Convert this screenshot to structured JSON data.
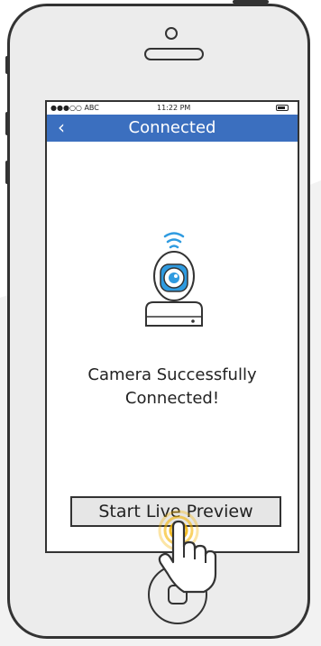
{
  "status_bar": {
    "carrier": "●●●○○ ABC",
    "time": "11:22 PM",
    "battery_icon": "battery-icon"
  },
  "nav": {
    "back_icon": "‹",
    "title": "Connected"
  },
  "content": {
    "camera_icon": "camera-wifi-icon",
    "message_line1": "Camera Successfully",
    "message_line2": "Connected!"
  },
  "actions": {
    "start_preview": "Start Live Preview"
  },
  "colors": {
    "accent": "#3b6fbf",
    "camera_blue": "#2f9be0",
    "tap_highlight": "#f5b400"
  }
}
